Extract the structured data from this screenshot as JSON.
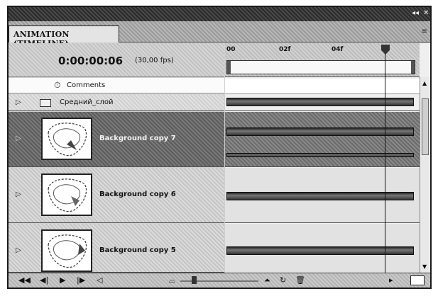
{
  "window": {
    "controls": [
      "◂◂",
      "✕"
    ]
  },
  "panel": {
    "tab_title": "ANIMATION (TIMELINE)",
    "menu_icon": "panel-menu-icon"
  },
  "time": {
    "timecode": "0:00:00:06",
    "fps": "(30,00 fps)"
  },
  "ruler": {
    "labels": [
      "00",
      "02f",
      "04f"
    ]
  },
  "comments_row": {
    "label": "Comments",
    "icon": "stopwatch-icon"
  },
  "group": {
    "name": "Средний_слой"
  },
  "layers": [
    {
      "name": "Background copy 7",
      "selected": true
    },
    {
      "name": "Background copy 6",
      "selected": false
    },
    {
      "name": "Background copy 5",
      "selected": false
    }
  ],
  "toolbar": {
    "icons": [
      "first-frame-icon",
      "previous-frame-icon",
      "play-icon",
      "next-frame-icon",
      "audio-icon",
      "zoom-out-icon",
      "zoom-slider",
      "zoom-in-icon",
      "tween-icon",
      "delete-icon",
      "convert-frame-icon"
    ]
  }
}
